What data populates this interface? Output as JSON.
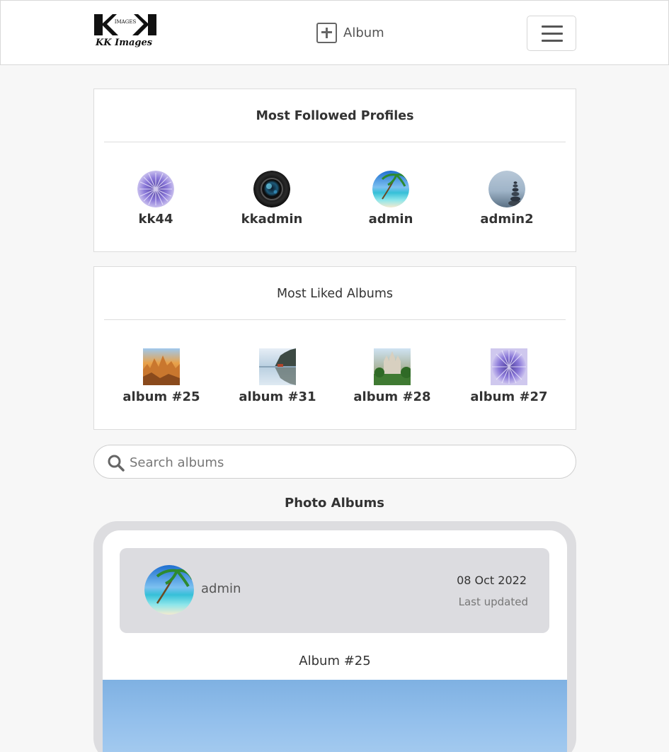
{
  "header": {
    "logo_text": "KK Images",
    "logo_mark_text": "IMAGES",
    "add_album_label": "Album",
    "menu_icon": "hamburger-menu-icon"
  },
  "most_followed": {
    "title": "Most Followed Profiles",
    "profiles": [
      {
        "name": "kk44",
        "avatar": "purple-flower"
      },
      {
        "name": "kkadmin",
        "avatar": "camera-lens"
      },
      {
        "name": "admin",
        "avatar": "tropical-beach"
      },
      {
        "name": "admin2",
        "avatar": "stone-cairn"
      }
    ]
  },
  "most_liked": {
    "title": "Most Liked Albums",
    "albums": [
      {
        "name": "album #25",
        "thumb": "rock-formations"
      },
      {
        "name": "album #31",
        "thumb": "lake-reflection"
      },
      {
        "name": "album #28",
        "thumb": "castle"
      },
      {
        "name": "album #27",
        "thumb": "purple-flower"
      }
    ]
  },
  "search": {
    "placeholder": "Search albums",
    "value": ""
  },
  "photo_albums": {
    "title": "Photo Albums",
    "first_album": {
      "owner": "admin",
      "date": "08 Oct 2022",
      "updated_label": "Last updated",
      "title": "Album #25"
    }
  },
  "colors": {
    "page_bg": "#f7f7f7",
    "frame_bg": "#dddde0",
    "owner_bar_bg": "#dcdce0"
  }
}
